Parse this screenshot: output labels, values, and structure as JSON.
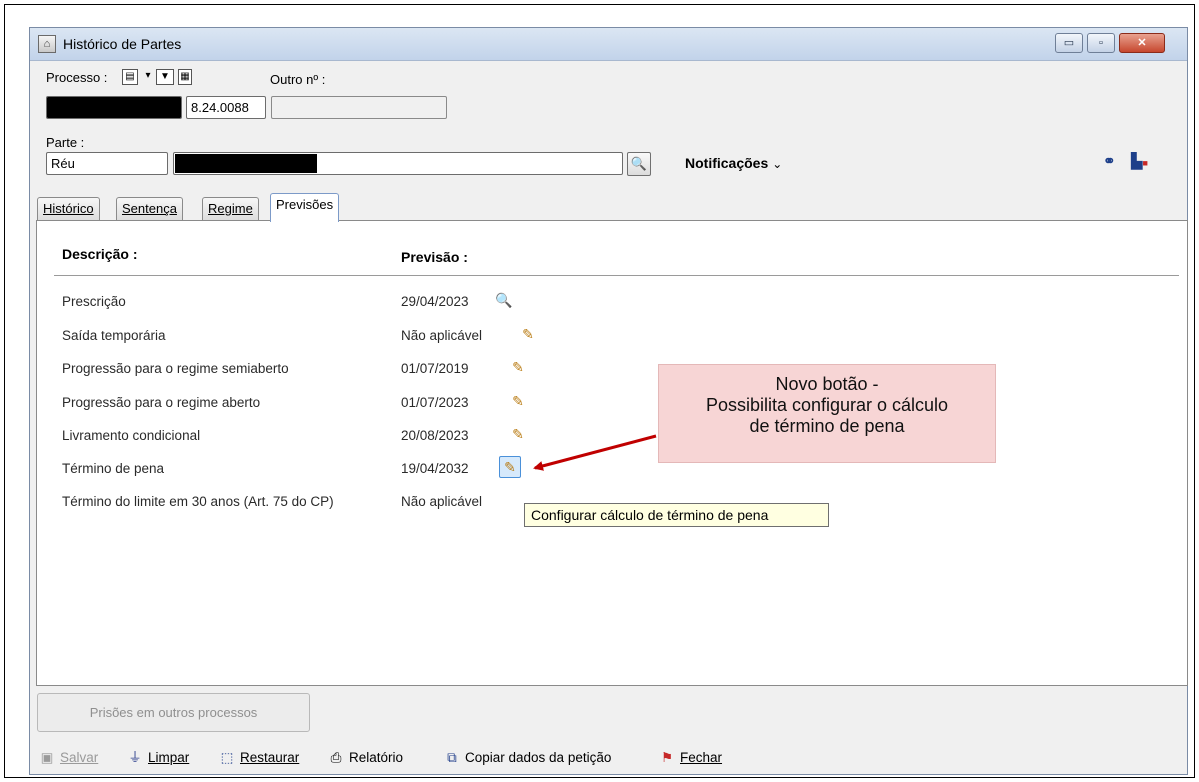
{
  "window": {
    "title": "Histórico de Partes",
    "minimize": "▭",
    "maximize": "▫",
    "close": "✕"
  },
  "header": {
    "processo_label": "Processo :",
    "outro_label": "Outro nº :",
    "processo_suffix": "8.24.0088",
    "outro_value": "",
    "parte_label": "Parte :",
    "parte_tipo": "Réu",
    "notificacoes_label": "Notificações",
    "notificacoes_chevron": "⌄"
  },
  "tabs": [
    {
      "label": "Histórico",
      "active": false
    },
    {
      "label": "Sentença",
      "active": false
    },
    {
      "label": "Regime",
      "active": false
    },
    {
      "label": "Previsões",
      "active": true
    }
  ],
  "table": {
    "col_descricao": "Descrição :",
    "col_previsao": "Previsão :",
    "rows": [
      {
        "descricao": "Prescrição",
        "previsao": "29/04/2023",
        "action": "search"
      },
      {
        "descricao": "Saída temporária",
        "previsao": "Não aplicável",
        "action": "edit"
      },
      {
        "descricao": "Progressão para o regime semiaberto",
        "previsao": "01/07/2019",
        "action": "edit"
      },
      {
        "descricao": "Progressão para o regime aberto",
        "previsao": "01/07/2023",
        "action": "edit"
      },
      {
        "descricao": "Livramento condicional",
        "previsao": "20/08/2023",
        "action": "edit"
      },
      {
        "descricao": "Término de pena",
        "previsao": "19/04/2032",
        "action": "edit"
      },
      {
        "descricao": "Término do limite em 30 anos (Art. 75 do CP)",
        "previsao": "Não aplicável",
        "action": ""
      }
    ]
  },
  "tooltip": "Configurar cálculo de término de pena",
  "callout": {
    "line1": "Novo botão -",
    "line2": "Possibilita configurar o cálculo",
    "line3": "de término de pena",
    "color": "#f7d5d5"
  },
  "footer": {
    "prisoes_button": "Prisões em outros processos",
    "salvar": "Salvar",
    "limpar": "Limpar",
    "restaurar": "Restaurar",
    "relatorio": "Relatório",
    "copiar": "Copiar dados da petição",
    "fechar": "Fechar"
  },
  "icons": {
    "search": "🔍",
    "edit": "✎",
    "binoculars": "⚭",
    "user_badge": "▙"
  }
}
